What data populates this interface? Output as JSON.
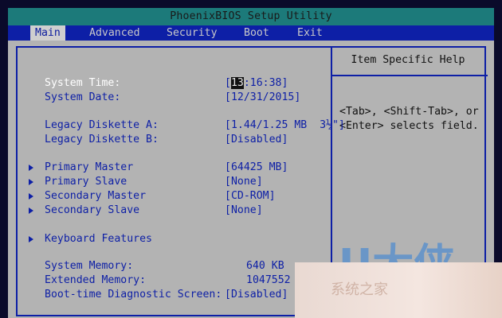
{
  "title": "PhoenixBIOS Setup Utility",
  "menu": [
    "Main",
    "Advanced",
    "Security",
    "Boot",
    "Exit"
  ],
  "help": {
    "title": "Item Specific Help",
    "line1": "<Tab>, <Shift-Tab>, or",
    "line2": "<Enter> selects field."
  },
  "fields": {
    "system_time": {
      "label": "System Time:",
      "value_cursor": "13",
      "value_rest": ":16:38]",
      "value_open": "["
    },
    "system_date": {
      "label": "System Date:",
      "value": "[12/31/2015]"
    },
    "diskette_a": {
      "label": "Legacy Diskette A:",
      "value": "[1.44/1.25 MB  3½\"]"
    },
    "diskette_b": {
      "label": "Legacy Diskette B:",
      "value": "[Disabled]"
    },
    "primary_master": {
      "label": "Primary Master",
      "value": "[64425 MB]"
    },
    "primary_slave": {
      "label": "Primary Slave",
      "value": "[None]"
    },
    "secondary_master": {
      "label": "Secondary Master",
      "value": "[CD-ROM]"
    },
    "secondary_slave": {
      "label": "Secondary Slave",
      "value": "[None]"
    },
    "keyboard_features": {
      "label": "Keyboard Features"
    },
    "system_memory": {
      "label": "System Memory:",
      "value": "640 KB"
    },
    "extended_memory": {
      "label": "Extended Memory:",
      "value": "1047552 KB"
    },
    "boot_diag": {
      "label": "Boot-time Diagnostic Screen:",
      "value": "[Disabled]"
    }
  },
  "watermark": "U大侠",
  "overlay_text": "系统之家"
}
